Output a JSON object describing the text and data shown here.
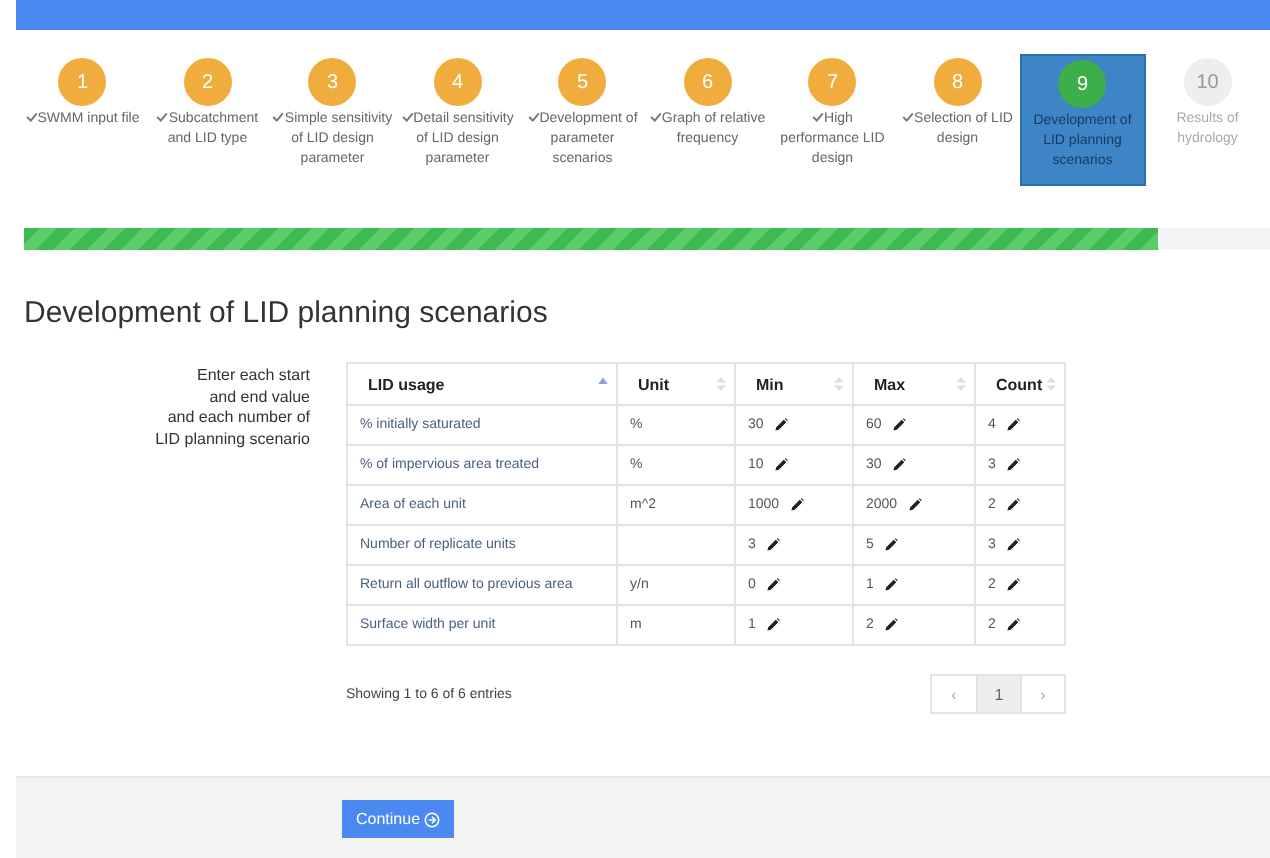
{
  "steps": [
    {
      "number": "1",
      "done": true,
      "selected": false,
      "label": "SWMM input file"
    },
    {
      "number": "2",
      "done": true,
      "selected": false,
      "label": "Subcatchment and LID type"
    },
    {
      "number": "3",
      "done": true,
      "selected": false,
      "label": "Simple sensitivity of LID design parameter"
    },
    {
      "number": "4",
      "done": true,
      "selected": false,
      "label": "Detail sensitivity of LID design parameter"
    },
    {
      "number": "5",
      "done": true,
      "selected": false,
      "label": "Development of parameter scenarios"
    },
    {
      "number": "6",
      "done": true,
      "selected": false,
      "label": "Graph of relative frequency"
    },
    {
      "number": "7",
      "done": true,
      "selected": false,
      "label": "High performance LID design"
    },
    {
      "number": "8",
      "done": true,
      "selected": false,
      "label": "Selection of LID design"
    },
    {
      "number": "9",
      "done": false,
      "selected": true,
      "label": "Development of LID planning scenarios"
    },
    {
      "number": "10",
      "done": false,
      "selected": false,
      "label": "Results of hydrology"
    }
  ],
  "progress": {
    "level": 0.91
  },
  "heading": "Development of LID planning scenarios",
  "instructions": [
    "Enter each start",
    "and end value",
    "and each number of",
    "LID planning scenario"
  ],
  "table": {
    "columns": [
      {
        "label": "LID usage",
        "sorted": true
      },
      {
        "label": "Unit",
        "sorted": false
      },
      {
        "label": "Min",
        "sorted": false
      },
      {
        "label": "Max",
        "sorted": false
      },
      {
        "label": "Count",
        "sorted": false
      }
    ],
    "rows": [
      {
        "usage": "% initially saturated",
        "unit": "%",
        "min": "30",
        "max": "60",
        "count": "4"
      },
      {
        "usage": "% of impervious area treated",
        "unit": "%",
        "min": "10",
        "max": "30",
        "count": "3"
      },
      {
        "usage": "Area of each unit",
        "unit": "m^2",
        "min": "1000",
        "max": "2000",
        "count": "2"
      },
      {
        "usage": "Number of replicate units",
        "min": "3",
        "max": "5",
        "count": "3"
      },
      {
        "usage": "Return all outflow to previous area",
        "unit": "y/n",
        "min": "0",
        "max": "1",
        "count": "2"
      },
      {
        "usage": "Surface width per unit",
        "unit": "m",
        "min": "1",
        "max": "2",
        "count": "2"
      }
    ]
  },
  "info": "Showing 1 to 6 of 6 entries",
  "pagination": [
    {
      "label": "‹",
      "kind": "prev",
      "selected": false
    },
    {
      "label": "1",
      "kind": "page",
      "selected": true
    },
    {
      "label": "›",
      "kind": "next",
      "selected": false
    }
  ],
  "continue_button": "Continue"
}
